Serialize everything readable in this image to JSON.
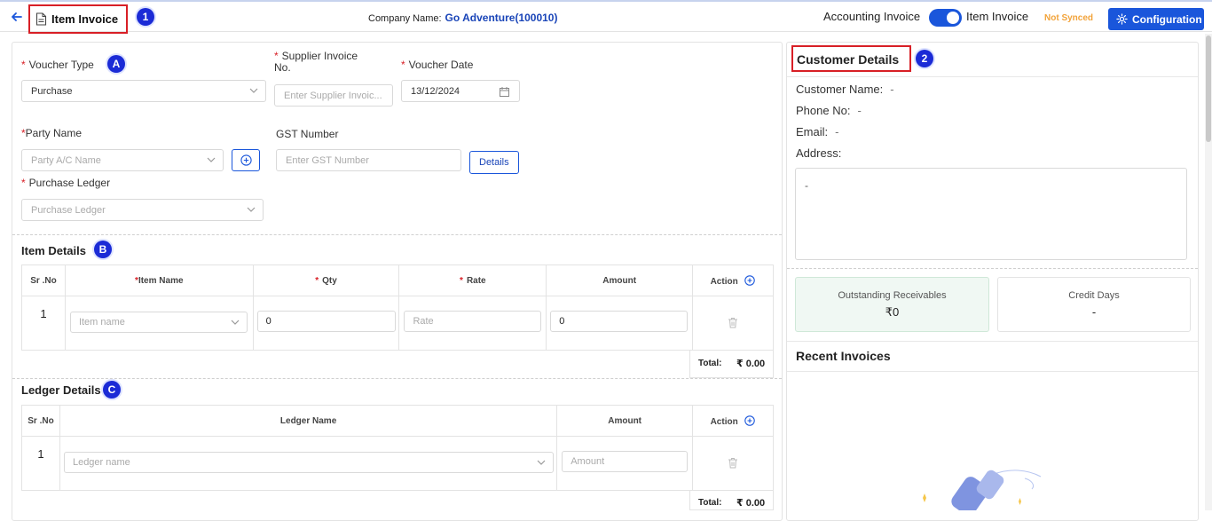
{
  "header": {
    "title": "Item Invoice",
    "badge_1": "1",
    "company_label": "Company Name:",
    "company_value": "Go Adventure(100010)",
    "accounting_label": "Accounting Invoice",
    "toggle_on": true,
    "item_label": "Item Invoice",
    "sync_status": "Not Synced",
    "config_label": "Configuration"
  },
  "form": {
    "badge_a": "A",
    "voucher_type_label": "Voucher Type",
    "voucher_type_value": "Purchase",
    "supplier_invoice_label": "Supplier Invoice No.",
    "supplier_invoice_placeholder": "Enter  Supplier Invoic...",
    "voucher_date_label": "Voucher Date",
    "voucher_date_value": "13/12/2024",
    "party_name_label": "Party Name",
    "party_name_placeholder": "Party A/C Name",
    "gst_label": "GST Number",
    "gst_placeholder": "Enter GST Number",
    "details_button": "Details",
    "purchase_ledger_label": "Purchase Ledger",
    "purchase_ledger_placeholder": "Purchase Ledger",
    "required_mark": "*"
  },
  "item_details": {
    "title": "Item Details",
    "badge": "B",
    "columns": [
      "Sr .No",
      "Item Name",
      "Qty",
      "Rate",
      "Amount",
      "Action"
    ],
    "row": {
      "sr": "1",
      "item_placeholder": "Item name",
      "qty": "0",
      "rate_placeholder": "Rate",
      "amount": "0"
    },
    "total_label": "Total:",
    "total_value": "₹ 0.00"
  },
  "ledger_details": {
    "title": "Ledger Details",
    "badge": "C",
    "columns": [
      "Sr .No",
      "Ledger Name",
      "Amount",
      "Action"
    ],
    "row": {
      "sr": "1",
      "ledger_placeholder": "Ledger name",
      "amount_placeholder": "Amount"
    },
    "total_label": "Total:",
    "total_value": "₹ 0.00"
  },
  "customer": {
    "title": "Customer Details",
    "badge": "2",
    "name_label": "Customer Name:",
    "name_value": "-",
    "phone_label": "Phone No:",
    "phone_value": "-",
    "email_label": "Email:",
    "email_value": "-",
    "address_label": "Address:",
    "address_value": "-",
    "outstanding_label": "Outstanding Receivables",
    "outstanding_value": "₹0",
    "credit_days_label": "Credit Days",
    "credit_days_value": "-",
    "recent_title": "Recent Invoices"
  },
  "colors": {
    "brand_blue": "#1a56db",
    "badge_blue": "#1b2bd6",
    "highlight_red": "#d81f26",
    "not_synced_orange": "#f2a33a",
    "outstanding_bg": "#f0f8f3"
  }
}
